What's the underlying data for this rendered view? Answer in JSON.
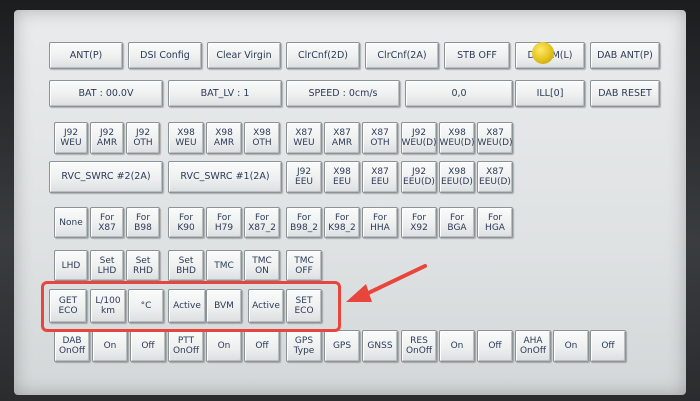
{
  "rows": [
    [
      {
        "id": "ant-p",
        "label": "ANT(P)"
      },
      {
        "id": "dsi-config",
        "label": "DSI Config"
      },
      {
        "id": "clear-virgin",
        "label": "Clear Virgin"
      },
      {
        "id": "clrcnf-2d",
        "label": "ClrCnf(2D)"
      },
      {
        "id": "clrcnf-2a",
        "label": "ClrCnf(2A)"
      },
      {
        "id": "stb-off",
        "label": "STB OFF"
      },
      {
        "id": "dab-om-l",
        "label": "DA  OM(L)"
      },
      {
        "id": "dab-ant-p",
        "label": "DAB ANT(P)"
      }
    ],
    [
      {
        "id": "bat",
        "label": "BAT : 00.0V"
      },
      {
        "id": "bat-lv",
        "label": "BAT_LV : 1"
      },
      {
        "id": "speed",
        "label": "SPEED : 0cm/s"
      },
      {
        "id": "coord",
        "label": "0,0"
      },
      {
        "id": "ill",
        "label": "ILL[0]"
      },
      {
        "id": "dab-reset",
        "label": "DAB RESET"
      }
    ],
    [
      {
        "id": "j92-weu",
        "label": "J92\nWEU"
      },
      {
        "id": "j92-amr",
        "label": "J92\nAMR"
      },
      {
        "id": "j92-oth",
        "label": "J92\nOTH"
      },
      {
        "id": "x98-weu",
        "label": "X98\nWEU"
      },
      {
        "id": "x98-amr",
        "label": "X98\nAMR"
      },
      {
        "id": "x98-oth",
        "label": "X98\nOTH"
      },
      {
        "id": "x87-weu",
        "label": "X87\nWEU"
      },
      {
        "id": "x87-amr",
        "label": "X87\nAMR"
      },
      {
        "id": "x87-oth",
        "label": "X87\nOTH"
      },
      {
        "id": "j92-weu-d",
        "label": "J92\nWEU(D)"
      },
      {
        "id": "x98-weu-d",
        "label": "X98\nWEU(D)"
      },
      {
        "id": "x87-weu-d",
        "label": "X87\nWEU(D)"
      }
    ],
    [
      {
        "id": "rvc-swrc-2",
        "label": "RVC_SWRC #2(2A)"
      },
      {
        "id": "rvc-swrc-1",
        "label": "RVC_SWRC #1(2A)"
      },
      {
        "id": "j92-eeu",
        "label": "J92\nEEU"
      },
      {
        "id": "x98-eeu",
        "label": "X98\nEEU"
      },
      {
        "id": "x87-eeu",
        "label": "X87\nEEU"
      },
      {
        "id": "j92-eeu-d",
        "label": "J92\nEEU(D)"
      },
      {
        "id": "x98-eeu-d",
        "label": "X98\nEEU(D)"
      },
      {
        "id": "x87-eeu-d",
        "label": "X87\nEEU(D)"
      }
    ],
    [
      {
        "id": "none",
        "label": "None"
      },
      {
        "id": "for-x87",
        "label": "For\nX87"
      },
      {
        "id": "for-b98",
        "label": "For\nB98"
      },
      {
        "id": "for-k90",
        "label": "For\nK90"
      },
      {
        "id": "for-h79",
        "label": "For\nH79"
      },
      {
        "id": "for-x87-2",
        "label": "For\nX87_2"
      },
      {
        "id": "for-b98-2",
        "label": "For\nB98_2"
      },
      {
        "id": "for-k98-2",
        "label": "For\nK98_2"
      },
      {
        "id": "for-hha",
        "label": "For\nHHA"
      },
      {
        "id": "for-x92",
        "label": "For\nX92"
      },
      {
        "id": "for-bga",
        "label": "For\nBGA"
      },
      {
        "id": "for-hga",
        "label": "For\nHGA"
      }
    ],
    [
      {
        "id": "lhd",
        "label": "LHD"
      },
      {
        "id": "set-lhd",
        "label": "Set\nLHD"
      },
      {
        "id": "set-rhd",
        "label": "Set\nRHD"
      },
      {
        "id": "set-bhd",
        "label": "Set\nBHD"
      },
      {
        "id": "tmc",
        "label": "TMC"
      },
      {
        "id": "tmc-on",
        "label": "TMC\nON"
      },
      {
        "id": "tmc-off",
        "label": "TMC\nOFF"
      }
    ],
    [
      {
        "id": "get-eco",
        "label": "GET\nECO"
      },
      {
        "id": "l-100km",
        "label": "L/100\nkm"
      },
      {
        "id": "celsius",
        "label": "°C"
      },
      {
        "id": "active-1",
        "label": "Active"
      },
      {
        "id": "bvm",
        "label": "BVM"
      },
      {
        "id": "active-2",
        "label": "Active"
      },
      {
        "id": "set-eco",
        "label": "SET\nECO"
      }
    ],
    [
      {
        "id": "dab-onoff",
        "label": "DAB\nOnOff"
      },
      {
        "id": "dab-on",
        "label": "On"
      },
      {
        "id": "dab-off",
        "label": "Off"
      },
      {
        "id": "ptt-onoff",
        "label": "PTT\nOnOff"
      },
      {
        "id": "ptt-on",
        "label": "On"
      },
      {
        "id": "ptt-off",
        "label": "Off"
      },
      {
        "id": "gps-type",
        "label": "GPS\nType"
      },
      {
        "id": "gps",
        "label": "GPS"
      },
      {
        "id": "gnss",
        "label": "GNSS"
      },
      {
        "id": "res-onoff",
        "label": "RES\nOnOff"
      },
      {
        "id": "res-on",
        "label": "On"
      },
      {
        "id": "res-off",
        "label": "Off"
      },
      {
        "id": "aha-onoff",
        "label": "AHA\nOnOff"
      },
      {
        "id": "aha-on",
        "label": "On"
      },
      {
        "id": "aha-off",
        "label": "Off"
      }
    ]
  ],
  "annotation": {
    "highlight_color": "#e8453c"
  }
}
